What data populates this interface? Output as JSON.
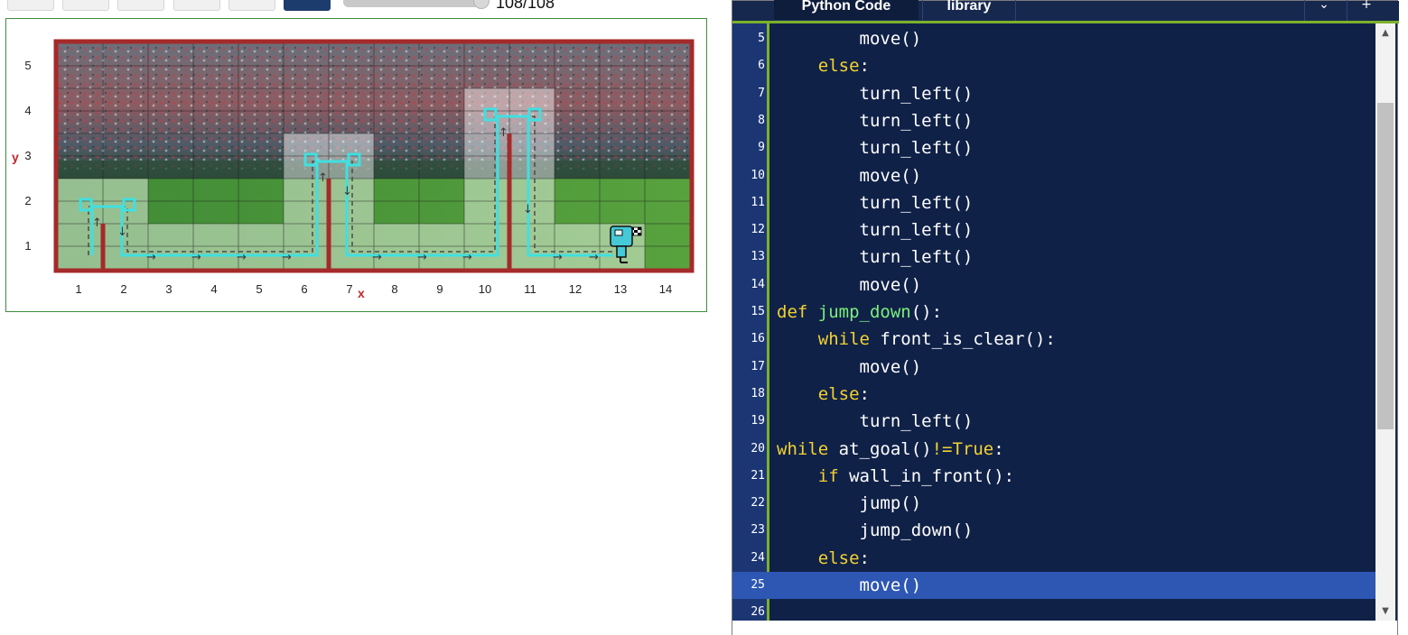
{
  "toolbar": {
    "buttons": [
      "first-step-button",
      "previous-step-button",
      "play-button",
      "pause-button",
      "stop-button",
      "zoom-button"
    ],
    "step_counter": "108/108",
    "progress_fraction": 1.0
  },
  "world": {
    "x_axis_name": "x",
    "y_axis_name": "y",
    "x_ticks": [
      "1",
      "2",
      "3",
      "4",
      "5",
      "6",
      "7",
      "8",
      "9",
      "10",
      "11",
      "12",
      "13",
      "14"
    ],
    "y_ticks": [
      "5",
      "4",
      "3",
      "2",
      "1"
    ],
    "colors": {
      "wall": "#a52a2a",
      "trace": "#40e0e0",
      "border": "#3e8f3e"
    }
  },
  "editor": {
    "tabs": [
      "Python Code",
      "library"
    ],
    "tab_controls": [
      "chevron-down-icon",
      "plus-icon"
    ],
    "lines": [
      {
        "n": "5",
        "indent": "        ",
        "tokens": [
          {
            "t": "move()",
            "c": ""
          }
        ]
      },
      {
        "n": "6",
        "indent": "    ",
        "tokens": [
          {
            "t": "else",
            "c": "kw"
          },
          {
            "t": ":",
            "c": ""
          }
        ]
      },
      {
        "n": "7",
        "indent": "        ",
        "tokens": [
          {
            "t": "turn_left()",
            "c": ""
          }
        ]
      },
      {
        "n": "8",
        "indent": "        ",
        "tokens": [
          {
            "t": "turn_left()",
            "c": ""
          }
        ]
      },
      {
        "n": "9",
        "indent": "        ",
        "tokens": [
          {
            "t": "turn_left()",
            "c": ""
          }
        ]
      },
      {
        "n": "10",
        "indent": "        ",
        "tokens": [
          {
            "t": "move()",
            "c": ""
          }
        ]
      },
      {
        "n": "11",
        "indent": "        ",
        "tokens": [
          {
            "t": "turn_left()",
            "c": ""
          }
        ]
      },
      {
        "n": "12",
        "indent": "        ",
        "tokens": [
          {
            "t": "turn_left()",
            "c": ""
          }
        ]
      },
      {
        "n": "13",
        "indent": "        ",
        "tokens": [
          {
            "t": "turn_left()",
            "c": ""
          }
        ]
      },
      {
        "n": "14",
        "indent": "        ",
        "tokens": [
          {
            "t": "move()",
            "c": ""
          }
        ]
      },
      {
        "n": "15",
        "indent": "",
        "tokens": [
          {
            "t": "def",
            "c": "kw"
          },
          {
            "t": " ",
            "c": ""
          },
          {
            "t": "jump_down",
            "c": "fn"
          },
          {
            "t": "():",
            "c": ""
          }
        ]
      },
      {
        "n": "16",
        "indent": "    ",
        "tokens": [
          {
            "t": "while",
            "c": "kw"
          },
          {
            "t": " front_is_clear():",
            "c": ""
          }
        ]
      },
      {
        "n": "17",
        "indent": "        ",
        "tokens": [
          {
            "t": "move()",
            "c": ""
          }
        ]
      },
      {
        "n": "18",
        "indent": "    ",
        "tokens": [
          {
            "t": "else",
            "c": "kw"
          },
          {
            "t": ":",
            "c": ""
          }
        ]
      },
      {
        "n": "19",
        "indent": "        ",
        "tokens": [
          {
            "t": "turn_left()",
            "c": ""
          }
        ]
      },
      {
        "n": "20",
        "indent": "",
        "tokens": [
          {
            "t": "while",
            "c": "kw"
          },
          {
            "t": " at_goal()",
            "c": ""
          },
          {
            "t": "!=",
            "c": "kw"
          },
          {
            "t": "True",
            "c": "kw"
          },
          {
            "t": ":",
            "c": ""
          }
        ]
      },
      {
        "n": "21",
        "indent": "    ",
        "tokens": [
          {
            "t": "if",
            "c": "kw"
          },
          {
            "t": " wall_in_front():",
            "c": ""
          }
        ]
      },
      {
        "n": "22",
        "indent": "        ",
        "tokens": [
          {
            "t": "jump()",
            "c": ""
          }
        ]
      },
      {
        "n": "23",
        "indent": "        ",
        "tokens": [
          {
            "t": "jump_down()",
            "c": ""
          }
        ]
      },
      {
        "n": "24",
        "indent": "    ",
        "tokens": [
          {
            "t": "else",
            "c": "kw"
          },
          {
            "t": ":",
            "c": ""
          }
        ]
      },
      {
        "n": "25",
        "indent": "        ",
        "tokens": [
          {
            "t": "move()",
            "c": ""
          }
        ],
        "highlight": true
      },
      {
        "n": "26",
        "indent": "",
        "tokens": []
      }
    ]
  }
}
